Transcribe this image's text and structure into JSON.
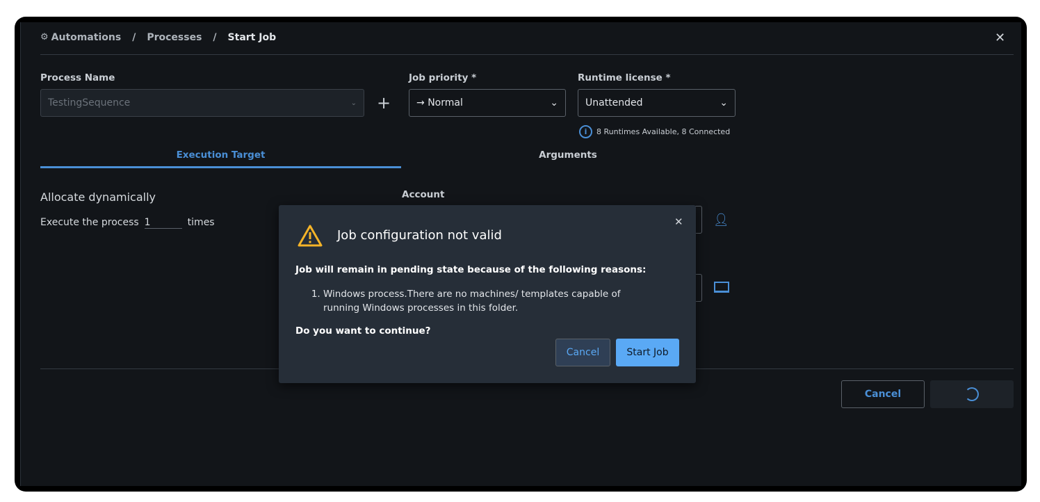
{
  "breadcrumb": {
    "items": [
      "Automations",
      "Processes",
      "Start Job"
    ],
    "separator": "/"
  },
  "form": {
    "process_name": {
      "label": "Process Name",
      "value": "TestingSequence"
    },
    "job_priority": {
      "label": "Job priority *",
      "value": "Normal"
    },
    "runtime_license": {
      "label": "Runtime license *",
      "value": "Unattended",
      "info": "8 Runtimes Available, 8 Connected"
    }
  },
  "tabs": [
    {
      "label": "Execution Target",
      "active": true
    },
    {
      "label": "Arguments",
      "active": false
    }
  ],
  "execution": {
    "heading": "Allocate dynamically",
    "execute_prefix": "Execute the process",
    "count": "1",
    "execute_suffix": "times",
    "account_label": "Account"
  },
  "footer": {
    "cancel": "Cancel"
  },
  "dialog": {
    "title": "Job configuration not valid",
    "intro": "Job will remain in pending state because of the following reasons:",
    "reasons": [
      "Windows process.There are no machines/ templates capable of running Windows processes in this folder."
    ],
    "question": "Do you want to continue?",
    "cancel": "Cancel",
    "confirm": "Start Job"
  },
  "colors": {
    "accent": "#4a8fd6",
    "primary_button": "#5aa9f5",
    "warning": "#f5b428",
    "background": "#121519",
    "dialog": "#262e38"
  }
}
